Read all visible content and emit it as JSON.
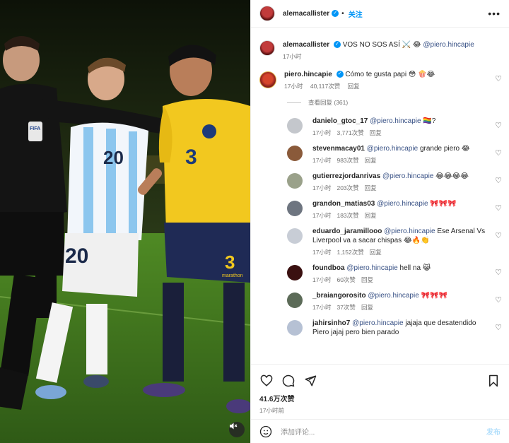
{
  "post": {
    "author": "alemacallister",
    "follow_label": "关注",
    "more_label": "•••",
    "caption_text": "VOS NO SOS ASÍ ⚔️ 😂",
    "caption_mention": "@piero.hincapie",
    "caption_time": "17小时"
  },
  "top_comment": {
    "user": "piero.hincapie",
    "text": "Cómo te gusta papi 😳 🍿😂",
    "time": "17小时",
    "likes": "40,117次赞",
    "reply_label": "回复",
    "view_replies": "查看回复 (361)"
  },
  "replies": [
    {
      "user": "danielo_gtoc_17",
      "mention": "@piero.hincapie",
      "text": "🏳️‍🌈?",
      "time": "17小时",
      "likes": "3,771次赞",
      "reply": "回复"
    },
    {
      "user": "stevenmacay01",
      "mention": "@piero.hincapie",
      "text": "grande piero 😂",
      "time": "17小时",
      "likes": "983次赞",
      "reply": "回复"
    },
    {
      "user": "gutierrezjordanrivas",
      "mention": "@piero.hincapie",
      "text": "😂😂😂😂",
      "time": "17小时",
      "likes": "203次赞",
      "reply": "回复"
    },
    {
      "user": "grandon_matias03",
      "mention": "@piero.hincapie",
      "text": "🎀🎀🎀",
      "time": "17小时",
      "likes": "183次赞",
      "reply": "回复"
    },
    {
      "user": "eduardo_jaramillooo",
      "mention": "@piero.hincapie",
      "text": "Ese Arsenal Vs Liverpool va a sacar chispas 😂🔥👏",
      "time": "17小时",
      "likes": "1,152次赞",
      "reply": "回复"
    },
    {
      "user": "foundboa",
      "mention": "@piero.hincapie",
      "text": "hell na 😹",
      "time": "17小时",
      "likes": "60次赞",
      "reply": "回复"
    },
    {
      "user": "_braiangorosito",
      "mention": "@piero.hincapie",
      "text": "🎀🎀🎀",
      "time": "17小时",
      "likes": "37次赞",
      "reply": "回复"
    },
    {
      "user": "jahirsinho7",
      "mention": "@piero.hincapie",
      "text": "jajaja que desatendido Piero jajaj pero bien parado",
      "time": "",
      "likes": "",
      "reply": ""
    }
  ],
  "footer": {
    "likes": "41.6万次赞",
    "time": "17小时前",
    "comment_placeholder": "添加评论...",
    "post_label": "发布"
  },
  "icons": {
    "like": "heart-icon",
    "comment": "comment-icon",
    "share": "share-icon",
    "save": "bookmark-icon",
    "emoji": "emoji-icon",
    "mute": "speaker-muted-icon"
  },
  "colors": {
    "accent": "#0095f6",
    "mention": "#385185",
    "meta": "#737373",
    "post_disabled": "#b2dffc",
    "ecuador_yellow": "#f2c81f",
    "argentina_sky": "#9fd0f2"
  },
  "photo": {
    "jersey_numbers": [
      "20",
      "3",
      "20",
      "3"
    ],
    "badge_text": "FIFA",
    "shorts_text": "marathon"
  }
}
